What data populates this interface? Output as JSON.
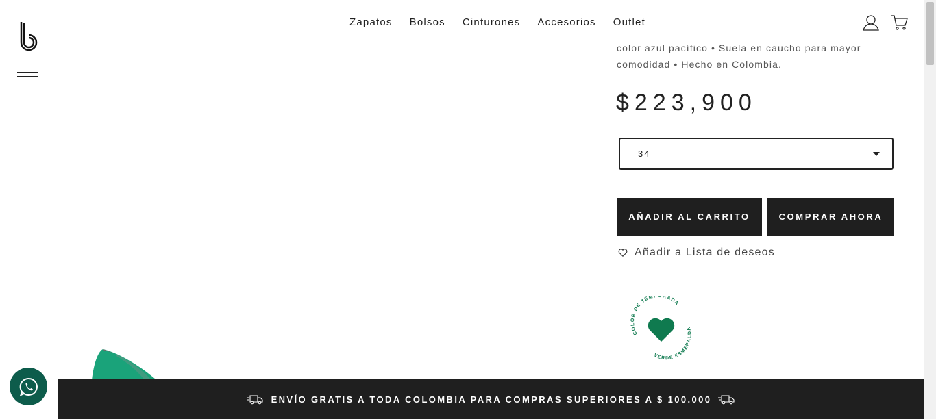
{
  "header": {
    "logo_icon": "b-logo-icon",
    "menu_icon": "hamburger-icon",
    "nav": [
      "Zapatos",
      "Bolsos",
      "Cinturones",
      "Accesorios",
      "Outlet"
    ],
    "account_icon": "user-icon",
    "cart_icon": "cart-icon"
  },
  "product": {
    "description": "color azul pacífico • Suela en caucho para mayor comodidad • Hecho en Colombia.",
    "price": "$223,900",
    "size_selected": "34",
    "add_to_cart_label": "AÑADIR AL CARRITO",
    "buy_now_label": "COMPRAR AHORA",
    "wishlist_label": "Añadir a Lista de deseos",
    "badge_top_text": "COLOR DE TEMPORADA",
    "badge_bottom_text": "VERDE ESMERALDA"
  },
  "promo": {
    "text": "ENVÍO GRATIS A TODA COLOMBIA PARA COMPRAS SUPERIORES A $ 100.000"
  },
  "colors": {
    "accent_green": "#0f7a4f",
    "dark": "#1f1f1f",
    "whatsapp": "#0d5c4b"
  }
}
